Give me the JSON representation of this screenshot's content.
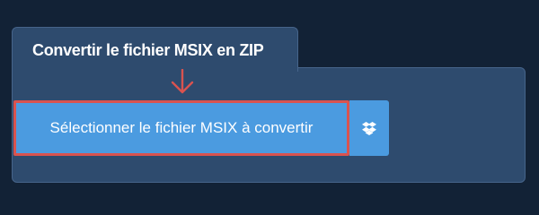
{
  "tab": {
    "title": "Convertir le fichier MSIX en ZIP"
  },
  "upload": {
    "select_label": "Sélectionner le fichier MSIX à convertir",
    "dropbox_icon": "dropbox-icon"
  },
  "colors": {
    "background": "#122236",
    "panel": "#2e4b6e",
    "button": "#4b9be0",
    "highlight": "#d9534f"
  }
}
